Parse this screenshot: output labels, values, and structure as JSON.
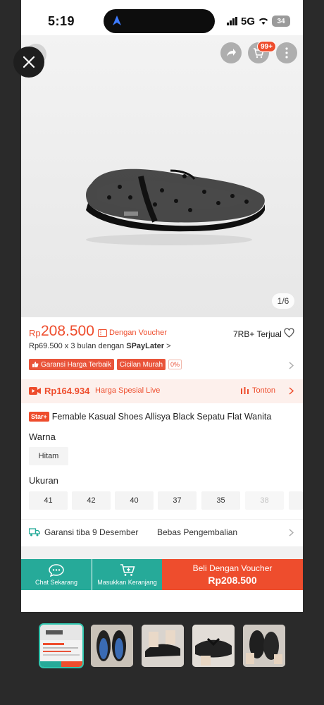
{
  "status_bar": {
    "time": "5:19",
    "network": "5G",
    "battery": "34"
  },
  "header": {
    "cart_badge": "99+",
    "icons": [
      "back-icon",
      "share-icon",
      "cart-icon",
      "more-icon"
    ]
  },
  "viewer": {
    "close_icon": "close-icon"
  },
  "gallery": {
    "counter": "1/6"
  },
  "price": {
    "currency": "Rp",
    "amount": "208.500",
    "voucher_label": "Dengan Voucher",
    "sold": "7RB+ Terjual",
    "installment": "Rp69.500 x 3 bulan dengan ",
    "installment_brand": "SPayLater",
    "installment_chevron": ">"
  },
  "badges": {
    "guarantee": "Garansi Harga Terbaik",
    "cicilan": "Cicilan Murah",
    "zero": "0%"
  },
  "live": {
    "price": "Rp164.934",
    "label": "Harga Spesial Live",
    "watch": "Tonton"
  },
  "product": {
    "star_badge": "Star+",
    "title": "Femable Kasual Shoes Allisya Black Sepatu Flat Wanita"
  },
  "variants": {
    "color_label": "Warna",
    "colors": [
      "Hitam"
    ],
    "size_label": "Ukuran",
    "sizes": [
      "41",
      "42",
      "40",
      "37",
      "35",
      "38"
    ],
    "disabled_sizes": [
      "38"
    ]
  },
  "shipping": {
    "guarantee": "Garansi tiba 9 Desember",
    "returns": "Bebas Pengembalian"
  },
  "bottom_bar": {
    "chat": "Chat Sekarang",
    "add_cart": "Masukkan Keranjang",
    "buy_label": "Beli Dengan Voucher",
    "buy_price": "Rp208.500"
  },
  "colors": {
    "brand": "#ee4d2d",
    "teal": "#26aa99",
    "thumb_active": "#2fc4ad"
  }
}
